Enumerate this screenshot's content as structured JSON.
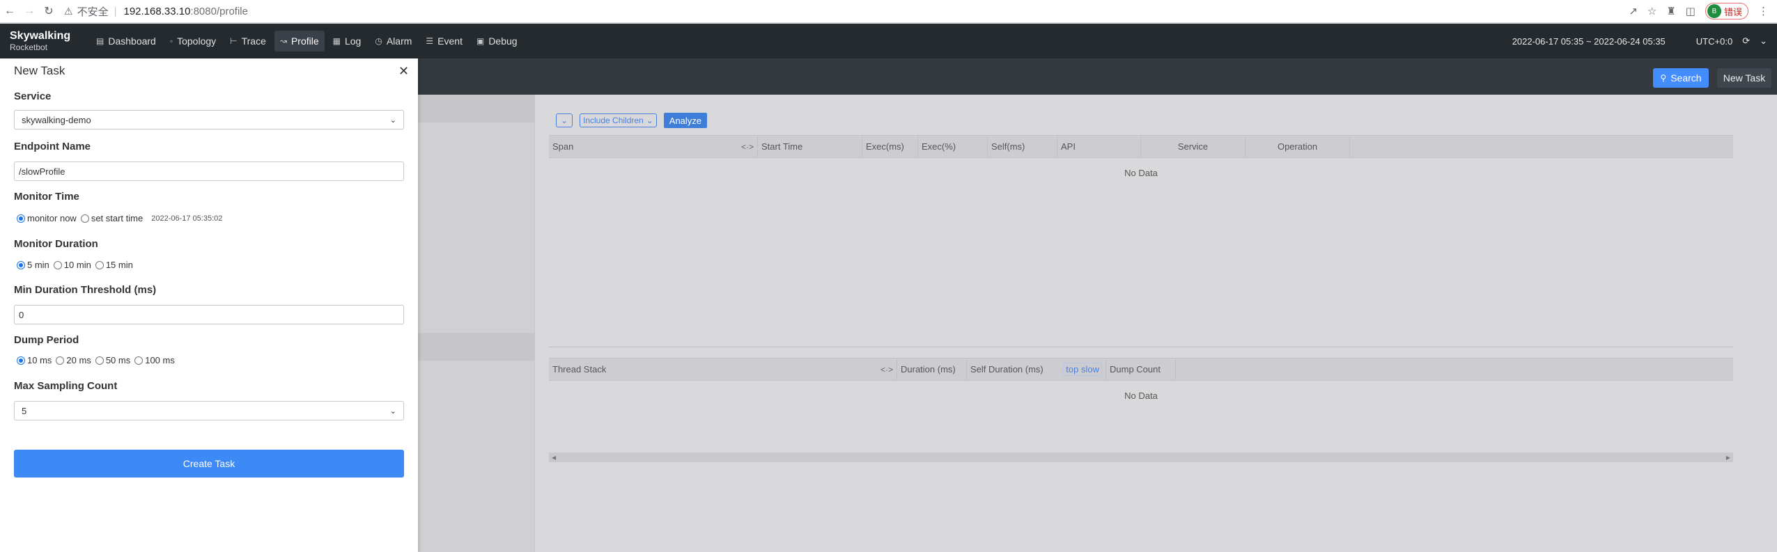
{
  "browser": {
    "insecure_label": "不安全",
    "url_host": "192.168.33.10",
    "url_path": ":8080/profile",
    "profile_label": "错误",
    "profile_initial": "B"
  },
  "app": {
    "logo_line1": "Skywalking",
    "logo_line2": "Rocketbot",
    "nav": [
      {
        "label": "Dashboard",
        "icon": "dashboard-icon"
      },
      {
        "label": "Topology",
        "icon": "topology-icon"
      },
      {
        "label": "Trace",
        "icon": "trace-icon"
      },
      {
        "label": "Profile",
        "icon": "profile-icon"
      },
      {
        "label": "Log",
        "icon": "log-icon"
      },
      {
        "label": "Alarm",
        "icon": "alarm-icon"
      },
      {
        "label": "Event",
        "icon": "event-icon"
      },
      {
        "label": "Debug",
        "icon": "debug-icon"
      }
    ],
    "active_nav": "Profile",
    "time_range": "2022-06-17 05:35 ~ 2022-06-24 05:35",
    "timezone": "UTC+0:0"
  },
  "toolbar": {
    "search_label": "Search",
    "new_task_label": "New Task"
  },
  "analysis": {
    "include_children": "Include Children",
    "analyze_label": "Analyze",
    "span_columns": [
      "Span",
      "Start Time",
      "Exec(ms)",
      "Exec(%)",
      "Self(ms)",
      "API",
      "Service",
      "Operation"
    ],
    "span_empty": "No Data",
    "thread_columns": [
      "Thread Stack",
      "Duration (ms)",
      "Self Duration (ms)",
      "top slow",
      "Dump Count"
    ],
    "thread_empty": "No Data"
  },
  "drawer": {
    "title": "New Task",
    "service_label": "Service",
    "service_value": "skywalking-demo",
    "endpoint_label": "Endpoint Name",
    "endpoint_value": "/slowProfile",
    "monitor_time_label": "Monitor Time",
    "monitor_time_options": [
      "monitor now",
      "set start time"
    ],
    "monitor_time_selected": "monitor now",
    "start_time_value": "2022-06-17 05:35:02",
    "monitor_duration_label": "Monitor Duration",
    "monitor_duration_options": [
      "5 min",
      "10 min",
      "15 min"
    ],
    "monitor_duration_selected": "5 min",
    "min_threshold_label": "Min Duration Threshold (ms)",
    "min_threshold_value": "0",
    "dump_period_label": "Dump Period",
    "dump_period_options": [
      "10 ms",
      "20 ms",
      "50 ms",
      "100 ms"
    ],
    "dump_period_selected": "10 ms",
    "max_sampling_label": "Max Sampling Count",
    "max_sampling_value": "5",
    "create_label": "Create Task"
  }
}
